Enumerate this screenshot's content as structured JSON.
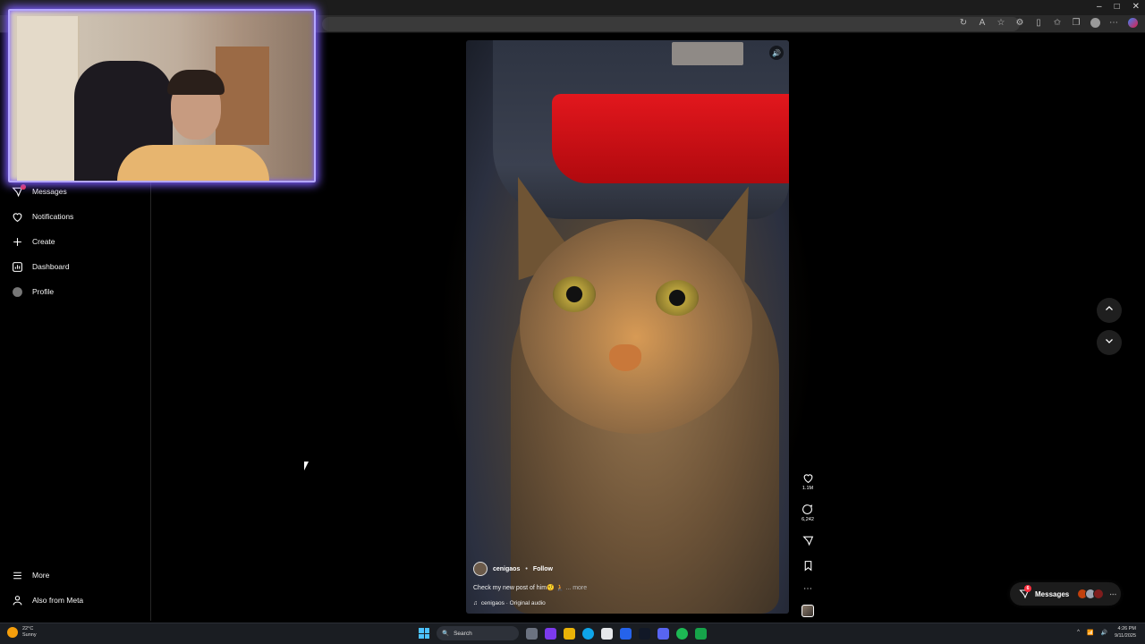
{
  "sidebar": {
    "items": [
      {
        "label": "Messages",
        "icon": "messages-icon"
      },
      {
        "label": "Notifications",
        "icon": "heart-icon"
      },
      {
        "label": "Create",
        "icon": "plus-icon"
      },
      {
        "label": "Dashboard",
        "icon": "dashboard-icon"
      },
      {
        "label": "Profile",
        "icon": "profile-icon"
      }
    ],
    "bottom": [
      {
        "label": "More",
        "icon": "menu-icon"
      },
      {
        "label": "Also from Meta",
        "icon": "meta-icon"
      }
    ]
  },
  "reel": {
    "author": "cenigaos",
    "separator": "•",
    "follow_label": "Follow",
    "caption": "Check my new post of him🤨 🧎",
    "more_label": "... more",
    "audio": "cenigaos · Original audio",
    "likes": "1.1M",
    "comments": "6,242"
  },
  "messages_pill": {
    "label": "Messages",
    "badge": "6"
  },
  "taskbar": {
    "temperature": "22°C",
    "condition": "Sunny",
    "search_placeholder": "Search",
    "time": "4:26 PM",
    "date": "9/11/2025"
  },
  "colors": {
    "accent_badge": "#ff3040",
    "webcam_border": "#b4a7ff",
    "taillight": "#e2171d"
  }
}
